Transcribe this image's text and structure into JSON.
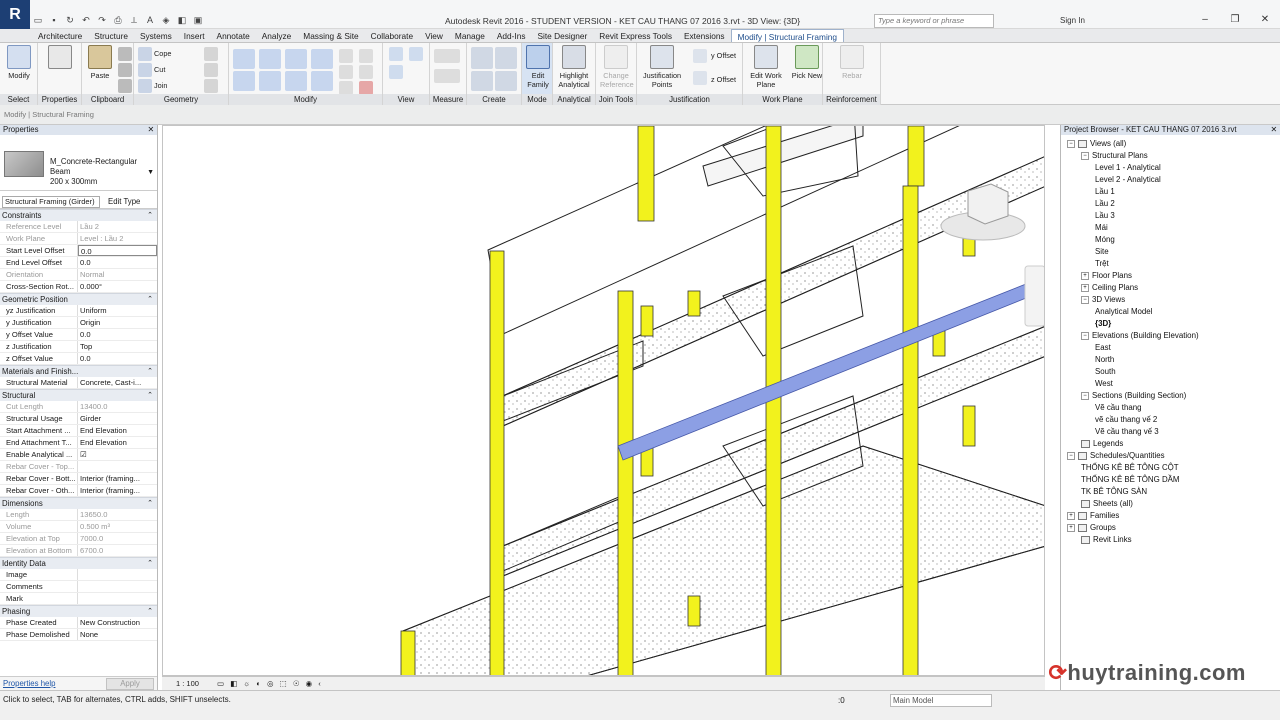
{
  "app": {
    "logo": "R",
    "title": "Autodesk Revit 2016 - STUDENT VERSION -     KET CAU THANG 07 2016 3.rvt - 3D View: {3D}",
    "search_placeholder": "Type a keyword or phrase",
    "sign_in": "Sign In"
  },
  "tabs": [
    "Architecture",
    "Structure",
    "Systems",
    "Insert",
    "Annotate",
    "Analyze",
    "Massing & Site",
    "Collaborate",
    "View",
    "Manage",
    "Add-Ins",
    "Site Designer",
    "Revit Express Tools",
    "Extensions",
    "Modify | Structural Framing"
  ],
  "ribbon": {
    "select": {
      "label": "Select",
      "modify": "Modify"
    },
    "properties": {
      "label": "Properties",
      "btn": "Properties"
    },
    "clipboard": {
      "label": "Clipboard",
      "paste": "Paste"
    },
    "geometry": {
      "label": "Geometry",
      "cope": "Cope",
      "cut": "Cut",
      "join": "Join"
    },
    "modify": {
      "label": "Modify"
    },
    "view": {
      "label": "View"
    },
    "measure": {
      "label": "Measure"
    },
    "create": {
      "label": "Create"
    },
    "mode": {
      "label": "Mode",
      "edit_family": "Edit Family"
    },
    "analytical": {
      "label": "Analytical",
      "highlight": "Highlight Analytical"
    },
    "join_tools": {
      "label": "Join Tools",
      "change_ref": "Change Reference"
    },
    "justification": {
      "label": "Justification",
      "points": "Justification Points",
      "y_offset": "y Offset",
      "z_offset": "z Offset"
    },
    "work_plane": {
      "label": "Work Plane",
      "edit_wp": "Edit Work Plane",
      "pick_new": "Pick New"
    },
    "reinforcement": {
      "label": "Reinforcement",
      "rebar": "Rebar"
    }
  },
  "options_bar": "Modify | Structural Framing",
  "properties": {
    "header": "Properties",
    "type_name": [
      "M_Concrete-Rectangular",
      "Beam",
      "200 x 300mm"
    ],
    "filter": "Structural Framing (Girder)",
    "edit_type": "Edit Type",
    "groups": [
      {
        "name": "Constraints",
        "rows": [
          {
            "n": "Reference Level",
            "v": "Lầu 2",
            "gray": true
          },
          {
            "n": "Work Plane",
            "v": "Level : Lầu 2",
            "gray": true
          },
          {
            "n": "Start Level Offset",
            "v": "0.0",
            "sel": true
          },
          {
            "n": "End Level Offset",
            "v": "0.0"
          },
          {
            "n": "Orientation",
            "v": "Normal",
            "gray": true
          },
          {
            "n": "Cross-Section Rot...",
            "v": "0.000°"
          }
        ]
      },
      {
        "name": "Geometric Position",
        "rows": [
          {
            "n": "yz Justification",
            "v": "Uniform"
          },
          {
            "n": "y Justification",
            "v": "Origin"
          },
          {
            "n": "y Offset Value",
            "v": "0.0"
          },
          {
            "n": "z Justification",
            "v": "Top"
          },
          {
            "n": "z Offset Value",
            "v": "0.0"
          }
        ]
      },
      {
        "name": "Materials and Finish...",
        "rows": [
          {
            "n": "Structural Material",
            "v": "Concrete, Cast-i..."
          }
        ]
      },
      {
        "name": "Structural",
        "rows": [
          {
            "n": "Cut Length",
            "v": "13400.0",
            "gray": true
          },
          {
            "n": "Structural Usage",
            "v": "Girder"
          },
          {
            "n": "Start Attachment ...",
            "v": "End Elevation"
          },
          {
            "n": "End Attachment T...",
            "v": "End Elevation"
          },
          {
            "n": "Enable Analytical ...",
            "v": "☑"
          },
          {
            "n": "Rebar Cover - Top...",
            "v": "",
            "gray": true
          },
          {
            "n": "Rebar Cover - Bott...",
            "v": "Interior (framing..."
          },
          {
            "n": "Rebar Cover - Oth...",
            "v": "Interior (framing..."
          }
        ]
      },
      {
        "name": "Dimensions",
        "rows": [
          {
            "n": "Length",
            "v": "13650.0",
            "gray": true
          },
          {
            "n": "Volume",
            "v": "0.500 m³",
            "gray": true
          },
          {
            "n": "Elevation at Top",
            "v": "7000.0",
            "gray": true
          },
          {
            "n": "Elevation at Bottom",
            "v": "6700.0",
            "gray": true
          }
        ]
      },
      {
        "name": "Identity Data",
        "rows": [
          {
            "n": "Image",
            "v": ""
          },
          {
            "n": "Comments",
            "v": ""
          },
          {
            "n": "Mark",
            "v": ""
          }
        ]
      },
      {
        "name": "Phasing",
        "rows": [
          {
            "n": "Phase Created",
            "v": "New Construction"
          },
          {
            "n": "Phase Demolished",
            "v": "None"
          }
        ]
      }
    ],
    "help": "Properties help",
    "apply": "Apply"
  },
  "viewbar": {
    "scale": "1 : 100"
  },
  "browser": {
    "header": "Project Browser - KET CAU THANG 07 2016 3.rvt",
    "nodes": [
      {
        "t": "Views (all)",
        "lvl": 0,
        "tog": "−",
        "ic": true
      },
      {
        "t": "Structural Plans",
        "lvl": 1,
        "tog": "−"
      },
      {
        "t": "Level 1 - Analytical",
        "lvl": 2
      },
      {
        "t": "Level 2 - Analytical",
        "lvl": 2
      },
      {
        "t": "Lầu 1",
        "lvl": 2
      },
      {
        "t": "Lầu 2",
        "lvl": 2
      },
      {
        "t": "Lầu 3",
        "lvl": 2
      },
      {
        "t": "Mái",
        "lvl": 2
      },
      {
        "t": "Móng",
        "lvl": 2
      },
      {
        "t": "Site",
        "lvl": 2
      },
      {
        "t": "Trệt",
        "lvl": 2
      },
      {
        "t": "Floor Plans",
        "lvl": 1,
        "tog": "+"
      },
      {
        "t": "Ceiling Plans",
        "lvl": 1,
        "tog": "+"
      },
      {
        "t": "3D Views",
        "lvl": 1,
        "tog": "−"
      },
      {
        "t": "Analytical Model",
        "lvl": 2
      },
      {
        "t": "{3D}",
        "lvl": 2,
        "bold": true
      },
      {
        "t": "Elevations (Building Elevation)",
        "lvl": 1,
        "tog": "−"
      },
      {
        "t": "East",
        "lvl": 2
      },
      {
        "t": "North",
        "lvl": 2
      },
      {
        "t": "South",
        "lvl": 2
      },
      {
        "t": "West",
        "lvl": 2
      },
      {
        "t": "Sections (Building Section)",
        "lvl": 1,
        "tog": "−"
      },
      {
        "t": "Vẽ cầu thang",
        "lvl": 2
      },
      {
        "t": "vẽ cầu thang vế 2",
        "lvl": 2
      },
      {
        "t": "Vẽ cầu thang vế 3",
        "lvl": 2
      },
      {
        "t": "Legends",
        "lvl": 0,
        "ic": true
      },
      {
        "t": "Schedules/Quantities",
        "lvl": 0,
        "tog": "−",
        "ic": true
      },
      {
        "t": "THỐNG KÊ BÊ TÔNG CỘT",
        "lvl": 1
      },
      {
        "t": "THỐNG KÊ BÊ TÔNG DẦM",
        "lvl": 1
      },
      {
        "t": "TK BÊ TÔNG SÀN",
        "lvl": 1
      },
      {
        "t": "Sheets (all)",
        "lvl": 0,
        "ic": true
      },
      {
        "t": "Families",
        "lvl": 0,
        "tog": "+",
        "ic": true
      },
      {
        "t": "Groups",
        "lvl": 0,
        "tog": "+",
        "ic": true
      },
      {
        "t": "Revit Links",
        "lvl": 0,
        "ic": true
      }
    ]
  },
  "status": {
    "text": "Click to select, TAB for alternates, CTRL adds, SHIFT unselects.",
    "model": "Main Model",
    "selection": ":0"
  },
  "watermark": "huytraining.com",
  "colors": {
    "column": "#f2f21d",
    "selected_beam": "#8c9fe4",
    "accent": "#1f4e8c"
  }
}
